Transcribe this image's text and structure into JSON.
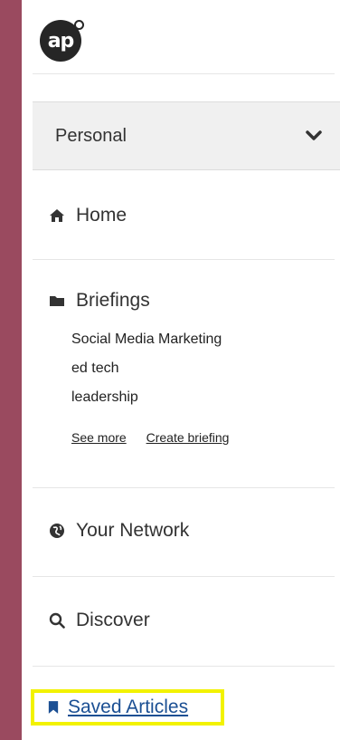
{
  "logo": {
    "text": "ap"
  },
  "dropdown": {
    "label": "Personal",
    "icon": "chevron-down-icon"
  },
  "nav": {
    "home": {
      "label": "Home",
      "icon": "home-icon"
    },
    "briefings": {
      "label": "Briefings",
      "icon": "folder-icon",
      "items": [
        "Social Media Marketing",
        "ed tech",
        "leadership"
      ],
      "see_more": "See more",
      "create": "Create briefing"
    },
    "network": {
      "label": "Your Network",
      "icon": "globe-icon"
    },
    "discover": {
      "label": "Discover",
      "icon": "search-icon"
    },
    "saved": {
      "label": "Saved Articles",
      "icon": "bookmark-icon",
      "color": "#1b4f93",
      "highlight": "#f2f200"
    }
  },
  "colors": {
    "background": "#9a4a5f",
    "panel": "#ffffff"
  }
}
